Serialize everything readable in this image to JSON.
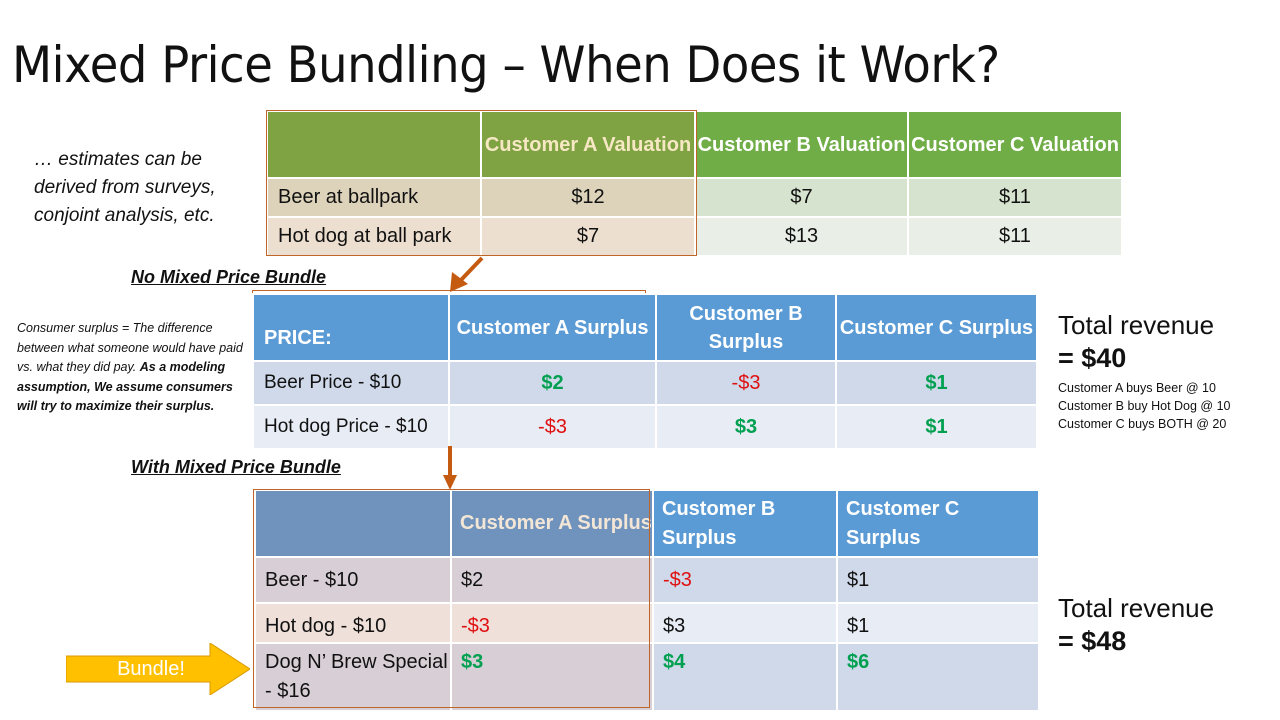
{
  "slide": {
    "title": "Mixed Price Bundling – When Does it Work?"
  },
  "notes": {
    "estimates": "… estimates can be derived from surveys, conjoint analysis, etc.",
    "surplus_definition": "Consumer surplus = The difference between what someone would have paid vs. what they did pay.",
    "modeling_assumption": "As a modeling assumption, We assume consumers will try to maximize their surplus."
  },
  "valuation_table": {
    "headers": [
      "",
      "Customer A Valuation",
      "Customer B Valuation",
      "Customer C Valuation"
    ],
    "rows": [
      {
        "label": "Beer at ballpark",
        "values": [
          "$12",
          "$7",
          "$11"
        ]
      },
      {
        "label": "Hot dog at ball park",
        "values": [
          "$7",
          "$13",
          "$11"
        ]
      }
    ]
  },
  "no_bundle": {
    "section_label": "No Mixed Price Bundle",
    "headers": [
      "PRICE:",
      "Customer A Surplus",
      "Customer B Surplus",
      "Customer C Surplus"
    ],
    "rows": [
      {
        "label": "Beer Price - $10",
        "values": [
          "$2",
          "-$3",
          "$1"
        ],
        "styles": [
          "pos",
          "neg",
          "pos"
        ]
      },
      {
        "label": "Hot dog Price - $10",
        "values": [
          "-$3",
          "$3",
          "$1"
        ],
        "styles": [
          "neg",
          "pos",
          "pos"
        ]
      }
    ],
    "total_label": "Total revenue",
    "total_value": "= $40",
    "details": [
      "Customer A buys Beer @ 10",
      "Customer B buy Hot Dog @ 10",
      "Customer C buys BOTH @ 20"
    ]
  },
  "with_bundle": {
    "section_label": "With Mixed Price Bundle",
    "headers": [
      "",
      "Customer A Surplus",
      "Customer B Surplus",
      "Customer C Surplus"
    ],
    "rows": [
      {
        "label": "Beer - $10",
        "values": [
          "$2",
          "-$3",
          "$1"
        ],
        "styles": [
          "plain",
          "neg",
          "plain"
        ]
      },
      {
        "label": "Hot dog - $10",
        "values": [
          "-$3",
          "$3",
          "$1"
        ],
        "styles": [
          "neg",
          "plain",
          "plain"
        ]
      },
      {
        "label": "Dog N’ Brew Special - $16",
        "values": [
          "$3",
          "$4",
          "$6"
        ],
        "styles": [
          "pos",
          "pos",
          "pos"
        ]
      }
    ],
    "callout": "Bundle!",
    "total_label": "Total revenue",
    "total_value": "= $48"
  },
  "colors": {
    "green_header": "#70ad47",
    "blue_header": "#5b9bd5",
    "positive": "#00a050",
    "negative": "#e01010",
    "highlight_border": "#c0652a",
    "callout_fill": "#ffc000"
  }
}
